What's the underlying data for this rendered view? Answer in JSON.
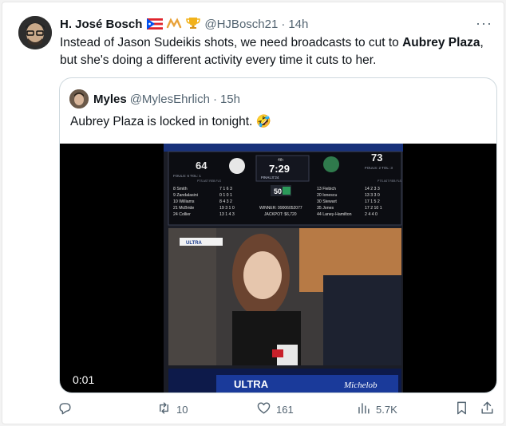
{
  "tweet": {
    "author_name": "H. José Bosch",
    "author_handle": "@HJBosch21",
    "separator": "·",
    "time": "14h",
    "more": "···",
    "text_parts": [
      "Instead of Jason Sudeikis shots, we need broadcasts to cut to ",
      "Aubrey Plaza",
      ", but she's doing a different activity every time it cuts to her."
    ],
    "badges": [
      "puerto-rico-flag-icon",
      "arms-icon",
      "trophy-icon"
    ]
  },
  "quote": {
    "author_name": "Myles",
    "author_handle": "@MylesEhrlich",
    "separator": "·",
    "time": "15h",
    "text": "Aubrey Plaza is locked in tonight. 🤣"
  },
  "video": {
    "timestamp": "0:01",
    "scoreboard": {
      "left_score": "64",
      "right_score": "73",
      "quarter": "4th",
      "clock": "7:29",
      "shot_clock": "50",
      "event": "FINALS'24",
      "left_fouls": "FOULS: 6   TOL: 1",
      "right_fouls": "FOULS: 2   TOL: 3",
      "stat_headers": "PTS  AST  REB  FLS",
      "left_players": [
        "8 Smith",
        "9 Zandalasini",
        "10 Williams",
        "21 McBride",
        "24 Collier"
      ],
      "left_stats": [
        "7  1  6  3",
        "0  1  0  1",
        "8  4  3  2",
        "19  3  1  0",
        "13  1  4  3"
      ],
      "right_players": [
        "13 Fiebich",
        "20 Ionescu",
        "30 Stewart",
        "35 Jones",
        "44 Laney-Hamilton"
      ],
      "right_stats": [
        "14  2  3  3",
        "13  3  3  0",
        "17  1  5  2",
        "17  2  10  1",
        "2  4  4  0"
      ],
      "winner": "WINNER: 99006052077",
      "jackpot": "JACKPOT: $6,720",
      "banner_left": "ULTRA",
      "banner_right": "Michelob",
      "banner_bottom": "ULTRA"
    }
  },
  "actions": {
    "reply": "",
    "retweet": "10",
    "like": "161",
    "views": "5.7K"
  },
  "colors": {
    "text": "#0f1419",
    "muted": "#536471",
    "border": "#cfd9de"
  }
}
